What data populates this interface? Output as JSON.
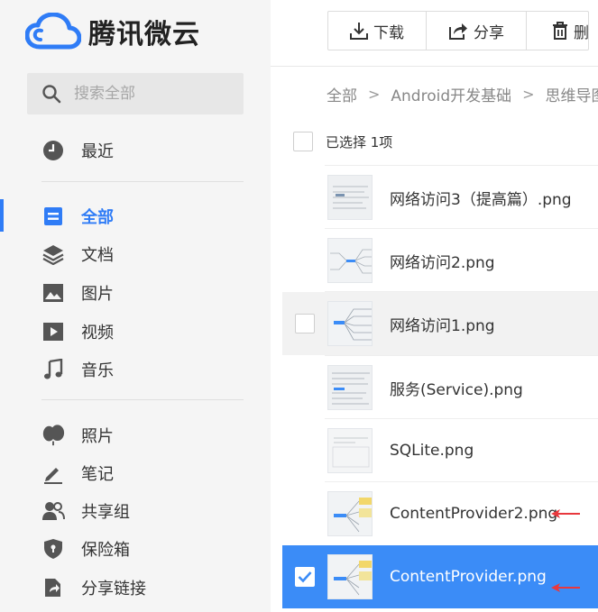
{
  "app": {
    "name": "腾讯微云"
  },
  "sidebar": {
    "search_placeholder": "搜索全部",
    "items": [
      {
        "label": "最近",
        "icon": "clock-icon"
      },
      {
        "label": "全部",
        "icon": "document-icon"
      },
      {
        "label": "文档",
        "icon": "layers-icon"
      },
      {
        "label": "图片",
        "icon": "image-icon"
      },
      {
        "label": "视频",
        "icon": "play-icon"
      },
      {
        "label": "音乐",
        "icon": "music-icon"
      },
      {
        "label": "照片",
        "icon": "balloon-icon"
      },
      {
        "label": "笔记",
        "icon": "pen-icon"
      },
      {
        "label": "共享组",
        "icon": "users-icon"
      },
      {
        "label": "保险箱",
        "icon": "shield-icon"
      },
      {
        "label": "分享链接",
        "icon": "share-link-icon"
      }
    ],
    "active_color": "#2f7cf6"
  },
  "toolbar": {
    "download_label": "下载",
    "share_label": "分享",
    "delete_label": "删"
  },
  "breadcrumb": {
    "items": [
      "全部",
      "Android开发基础",
      "思维导图"
    ]
  },
  "selection": {
    "label": "已选择 1项"
  },
  "files": [
    {
      "name": "网络访问3（提高篇）.png"
    },
    {
      "name": "网络访问2.png"
    },
    {
      "name": "网络访问1.png"
    },
    {
      "name": "服务(Service).png"
    },
    {
      "name": "SQLite.png"
    },
    {
      "name": "ContentProvider2.png"
    },
    {
      "name": "ContentProvider.png"
    }
  ],
  "colors": {
    "selected_row": "#3b8cf7",
    "arrow": "#e8383d"
  }
}
